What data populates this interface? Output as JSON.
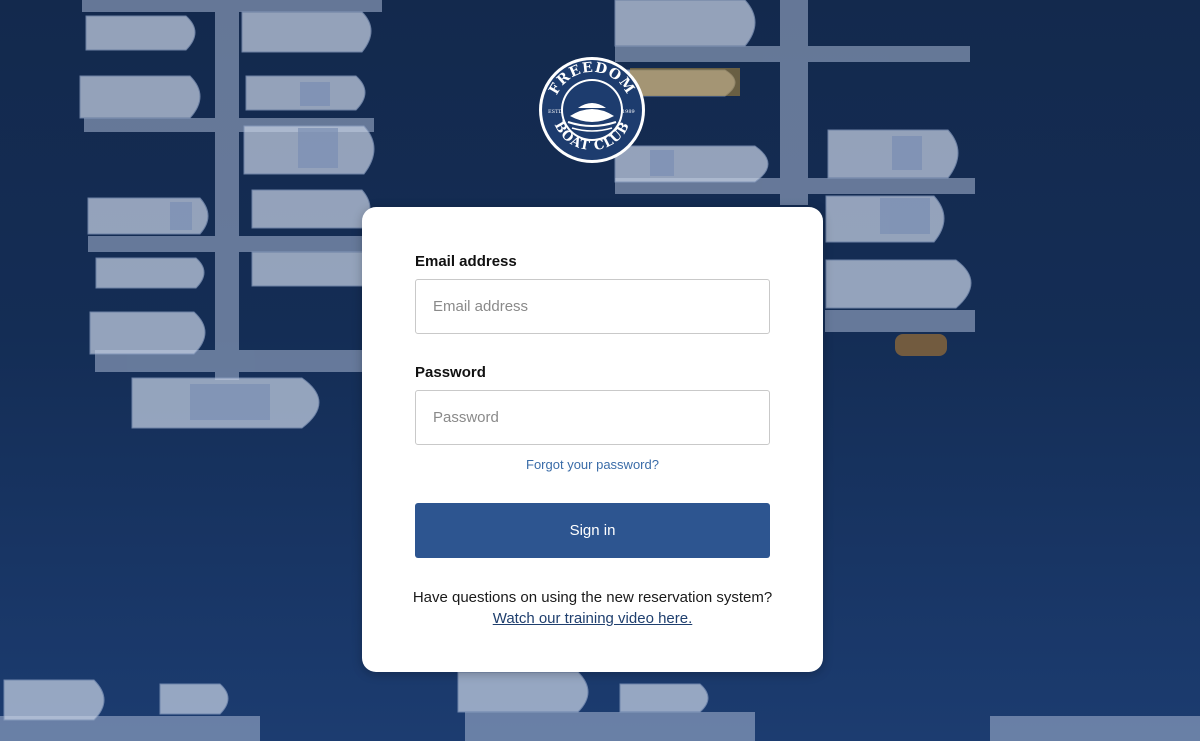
{
  "logo": {
    "top_text": "FREEDOM",
    "bottom_text": "BOAT CLUB",
    "left_text": "ESTD",
    "right_text": "1989",
    "icon": "boat-emblem-icon"
  },
  "form": {
    "email_label": "Email address",
    "email_placeholder": "Email address",
    "email_value": "",
    "password_label": "Password",
    "password_placeholder": "Password",
    "password_value": "",
    "forgot_link": "Forgot your password?",
    "signin_label": "Sign in"
  },
  "help": {
    "question": "Have questions on using the new reservation system?",
    "link": "Watch our training video here."
  },
  "colors": {
    "background": "#13294d",
    "button": "#2d5590",
    "link": "#3a6ca8",
    "card": "#ffffff"
  }
}
